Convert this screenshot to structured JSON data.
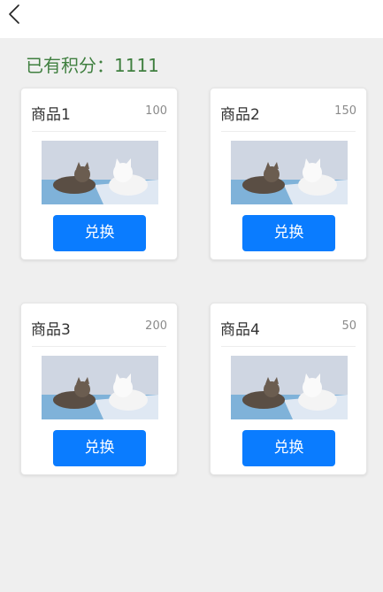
{
  "header": {
    "back_icon": "chevron-left-icon"
  },
  "points": {
    "label": "已有积分：1111"
  },
  "products": [
    {
      "name": "商品1",
      "price": "100",
      "button": "兑换",
      "image": "cats-photo"
    },
    {
      "name": "商品2",
      "price": "150",
      "button": "兑换",
      "image": "cats-photo"
    },
    {
      "name": "商品3",
      "price": "200",
      "button": "兑换",
      "image": "cats-photo"
    },
    {
      "name": "商品4",
      "price": "50",
      "button": "兑换",
      "image": "cats-photo"
    }
  ],
  "colors": {
    "accent": "#0a7cff",
    "points_text": "#3f7f3f",
    "background": "#efefef"
  }
}
